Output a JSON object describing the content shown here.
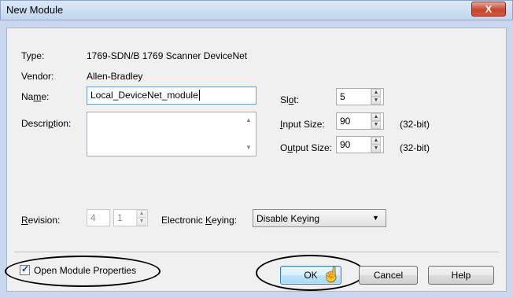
{
  "window": {
    "title": "New Module",
    "close_glyph": "X"
  },
  "module": {
    "type_label": "Type:",
    "type_value": "1769-SDN/B 1769 Scanner DeviceNet",
    "vendor_label": "Vendor:",
    "vendor_value": "Allen-Bradley",
    "name_label_pre": "Na",
    "name_label_u": "m",
    "name_label_post": "e:",
    "name_value": "Local_DeviceNet_module",
    "description_label_pre": "Descri",
    "description_label_u": "p",
    "description_label_post": "tion:",
    "description_value": ""
  },
  "slot": {
    "label_pre": "Sl",
    "label_u": "o",
    "label_post": "t:",
    "value": "5"
  },
  "input_size": {
    "label_pre": "",
    "label_u": "I",
    "label_post": "nput Size:",
    "value": "90",
    "unit": "(32-bit)"
  },
  "output_size": {
    "label_pre": "O",
    "label_u": "u",
    "label_post": "tput Size:",
    "value": "90",
    "unit": "(32-bit)"
  },
  "revision": {
    "label_pre": "",
    "label_u": "R",
    "label_post": "evision:",
    "major": "4",
    "minor": "1"
  },
  "keying": {
    "label_pre": "Electronic ",
    "label_u": "K",
    "label_post": "eying:",
    "value": "Disable Keying"
  },
  "open_props": {
    "label": "Open Module Properties",
    "checked": true
  },
  "buttons": {
    "ok": "OK",
    "cancel": "Cancel",
    "help": "Help"
  },
  "colors": {
    "ellipse": "#000000",
    "ok_border": "#3c7fb1"
  }
}
